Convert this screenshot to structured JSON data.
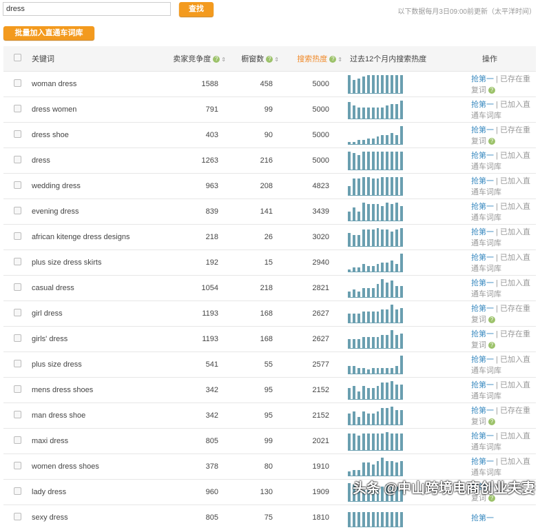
{
  "search": {
    "value": "dress",
    "button": "查找"
  },
  "note": "以下数据每月3日09:00前更新（太平洋时间）",
  "batch_button": "批量加入直通车词库",
  "headers": {
    "keyword": "关键词",
    "competition": "卖家竞争度",
    "showcase": "橱窗数",
    "heat": "搜索热度",
    "trend": "过去12个月内搜索热度",
    "action": "操作"
  },
  "action_link": "抢第一",
  "accent": "#f39a1e",
  "rows": [
    {
      "kw": "woman dress",
      "c": "1588",
      "s": "458",
      "h": "5000",
      "st": "已存在重复词",
      "dup": true,
      "t": [
        10,
        7,
        8,
        9,
        10,
        10,
        10,
        10,
        10,
        10,
        10,
        10
      ]
    },
    {
      "kw": "dress women",
      "c": "791",
      "s": "99",
      "h": "5000",
      "st": "已加入直通车词库",
      "dup": false,
      "t": [
        9,
        7,
        6,
        6,
        6,
        6,
        6,
        6,
        7,
        8,
        8,
        10
      ]
    },
    {
      "kw": "dress shoe",
      "c": "403",
      "s": "90",
      "h": "5000",
      "st": "已存在重复词",
      "dup": true,
      "t": [
        1,
        1,
        2,
        2,
        3,
        3,
        4,
        5,
        5,
        6,
        5,
        10
      ]
    },
    {
      "kw": "dress",
      "c": "1263",
      "s": "216",
      "h": "5000",
      "st": "已加入直通车词库",
      "dup": false,
      "t": [
        10,
        9,
        8,
        10,
        10,
        10,
        10,
        10,
        10,
        10,
        10,
        10
      ]
    },
    {
      "kw": "wedding dress",
      "c": "963",
      "s": "208",
      "h": "4823",
      "st": "已加入直通车词库",
      "dup": false,
      "t": [
        5,
        9,
        9,
        10,
        10,
        9,
        9,
        10,
        10,
        10,
        10,
        10
      ]
    },
    {
      "kw": "evening dress",
      "c": "839",
      "s": "141",
      "h": "3439",
      "st": "已加入直通车词库",
      "dup": false,
      "t": [
        5,
        7,
        5,
        10,
        9,
        9,
        9,
        8,
        10,
        9,
        10,
        8
      ]
    },
    {
      "kw": "african kitenge dress designs",
      "c": "218",
      "s": "26",
      "h": "3020",
      "st": "已加入直通车词库",
      "dup": false,
      "t": [
        7,
        6,
        6,
        9,
        9,
        9,
        10,
        9,
        9,
        8,
        9,
        10
      ]
    },
    {
      "kw": "plus size dress skirts",
      "c": "192",
      "s": "15",
      "h": "2940",
      "st": "已加入直通车词库",
      "dup": false,
      "t": [
        1,
        2,
        2,
        4,
        3,
        3,
        4,
        5,
        5,
        6,
        4,
        10
      ]
    },
    {
      "kw": "casual dress",
      "c": "1054",
      "s": "218",
      "h": "2821",
      "st": "已加入直通车词库",
      "dup": false,
      "t": [
        3,
        4,
        3,
        5,
        5,
        5,
        7,
        10,
        8,
        9,
        6,
        6
      ]
    },
    {
      "kw": "girl dress",
      "c": "1193",
      "s": "168",
      "h": "2627",
      "st": "已存在重复词",
      "dup": true,
      "t": [
        5,
        5,
        5,
        6,
        6,
        6,
        6,
        7,
        7,
        10,
        7,
        8
      ]
    },
    {
      "kw": "girls' dress",
      "c": "1193",
      "s": "168",
      "h": "2627",
      "st": "已存在重复词",
      "dup": true,
      "t": [
        5,
        5,
        5,
        6,
        6,
        6,
        6,
        7,
        7,
        10,
        7,
        8
      ]
    },
    {
      "kw": "plus size dress",
      "c": "541",
      "s": "55",
      "h": "2577",
      "st": "已加入直通车词库",
      "dup": false,
      "t": [
        4,
        4,
        3,
        3,
        2,
        3,
        3,
        3,
        3,
        3,
        4,
        10
      ]
    },
    {
      "kw": "mens dress shoes",
      "c": "342",
      "s": "95",
      "h": "2152",
      "st": "已加入直通车词库",
      "dup": false,
      "t": [
        6,
        7,
        4,
        7,
        6,
        6,
        7,
        9,
        9,
        10,
        8,
        8
      ]
    },
    {
      "kw": "man dress shoe",
      "c": "342",
      "s": "95",
      "h": "2152",
      "st": "已存在重复词",
      "dup": true,
      "t": [
        6,
        7,
        4,
        7,
        6,
        6,
        7,
        9,
        9,
        10,
        8,
        8
      ]
    },
    {
      "kw": "maxi dress",
      "c": "805",
      "s": "99",
      "h": "2021",
      "st": "已加入直通车词库",
      "dup": false,
      "t": [
        9,
        9,
        8,
        9,
        9,
        9,
        9,
        9,
        10,
        9,
        9,
        9
      ]
    },
    {
      "kw": "women dress shoes",
      "c": "378",
      "s": "80",
      "h": "1910",
      "st": "已加入直通车词库",
      "dup": false,
      "t": [
        2,
        3,
        3,
        7,
        7,
        6,
        8,
        10,
        8,
        8,
        7,
        8
      ]
    },
    {
      "kw": "lady dress",
      "c": "960",
      "s": "130",
      "h": "1909",
      "st": "已存在重复词",
      "dup": true,
      "t": [
        10,
        9,
        7,
        6,
        6,
        6,
        7,
        8,
        9,
        8,
        8,
        6
      ]
    },
    {
      "kw": "sexy dress",
      "c": "805",
      "s": "75",
      "h": "1810",
      "st": "",
      "dup": false,
      "t": [
        8,
        8,
        8,
        8,
        8,
        8,
        8,
        8,
        8,
        8,
        8,
        8
      ]
    }
  ],
  "watermark": "头条 @中山跨境电商创业夫妻"
}
